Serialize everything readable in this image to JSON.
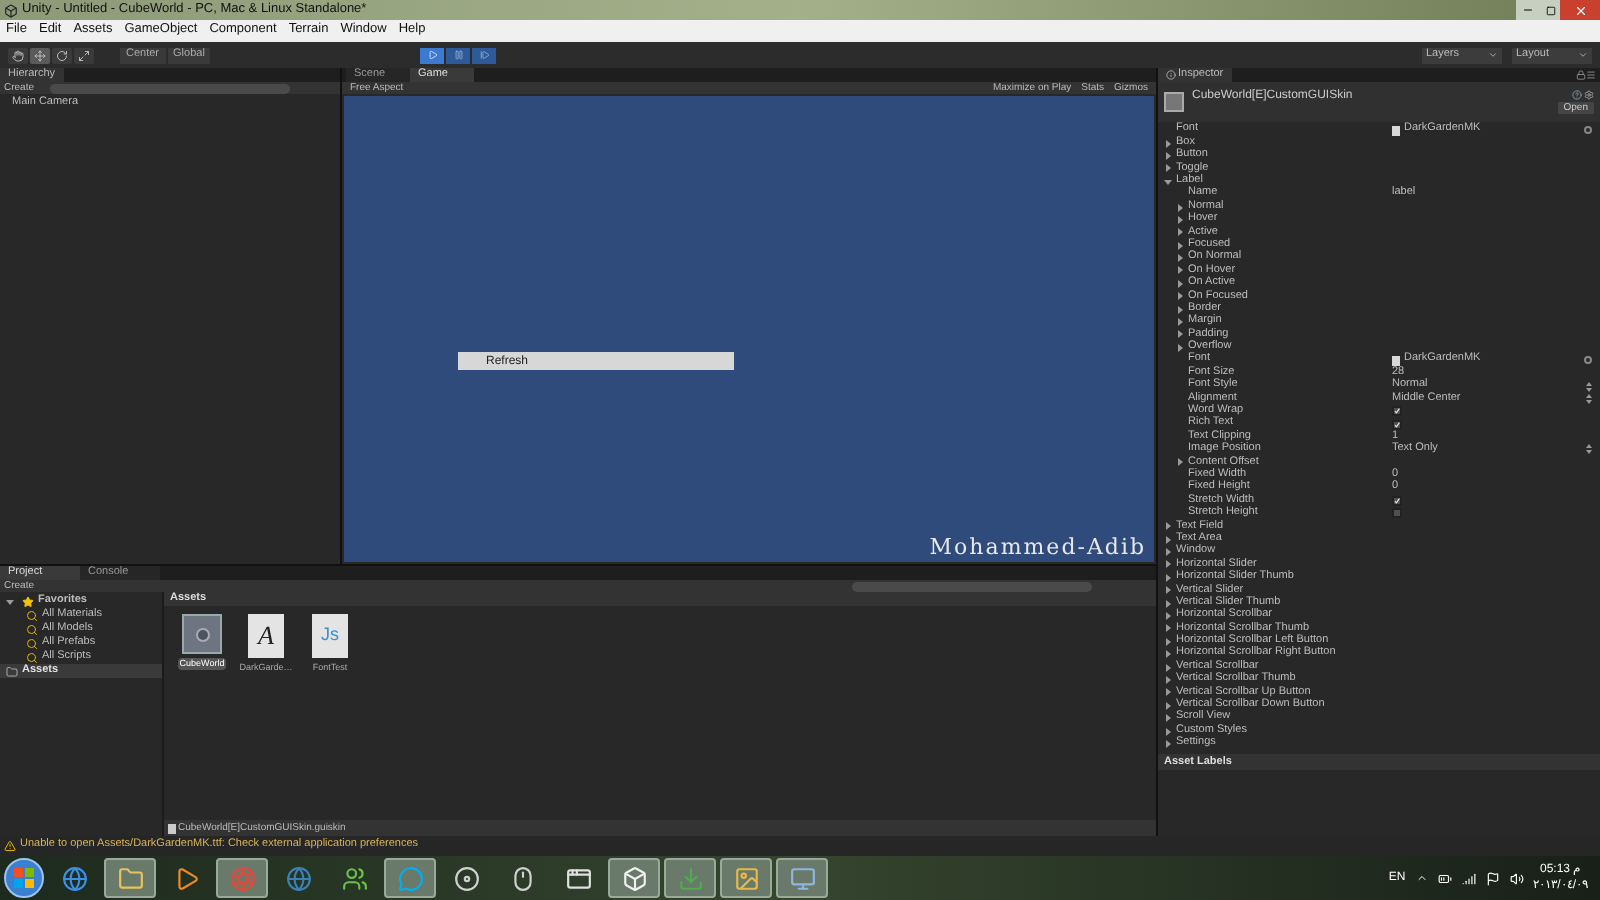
{
  "window": {
    "title": "Unity - Untitled - CubeWorld - PC, Mac & Linux Standalone*"
  },
  "menu": [
    "File",
    "Edit",
    "Assets",
    "GameObject",
    "Component",
    "Terrain",
    "Window",
    "Help"
  ],
  "toolbar": {
    "tools": [
      {
        "kind": "hand",
        "selected": false
      },
      {
        "kind": "move",
        "selected": true
      },
      {
        "kind": "rotate",
        "selected": false
      },
      {
        "kind": "scale",
        "selected": false
      }
    ],
    "pivot": [
      "Center",
      "Global"
    ],
    "playback": [
      {
        "kind": "play",
        "on": true
      },
      {
        "kind": "pause",
        "on": false
      },
      {
        "kind": "step",
        "on": false
      }
    ],
    "layers": "Layers",
    "layout": "Layout"
  },
  "hierarchy": {
    "tab": "Hierarchy",
    "create": "Create",
    "items": [
      "Main Camera"
    ]
  },
  "game": {
    "tabs": [
      {
        "label": "Scene",
        "selected": false
      },
      {
        "label": "Game",
        "selected": true
      }
    ],
    "aspect": "Free Aspect",
    "options": [
      "Maximize on Play",
      "Stats",
      "Gizmos"
    ],
    "button": "Refresh",
    "label": "Mohammed-Adib"
  },
  "inspector": {
    "tab": "Inspector",
    "asset": "CubeWorld[E]CustomGUISkin",
    "open": "Open",
    "rows": [
      {
        "kind": "object",
        "label": "Font",
        "value": "DarkGardenMK"
      },
      {
        "kind": "foldout",
        "label": "Box",
        "expanded": false
      },
      {
        "kind": "foldout",
        "label": "Button",
        "expanded": false
      },
      {
        "kind": "foldout",
        "label": "Toggle",
        "expanded": false
      },
      {
        "kind": "foldout",
        "label": "Label",
        "expanded": true,
        "children": [
          {
            "kind": "text",
            "label": "Name",
            "value": "label"
          },
          {
            "kind": "foldout",
            "label": "Normal",
            "expanded": false
          },
          {
            "kind": "foldout",
            "label": "Hover",
            "expanded": false
          },
          {
            "kind": "foldout",
            "label": "Active",
            "expanded": false
          },
          {
            "kind": "foldout",
            "label": "Focused",
            "expanded": false
          },
          {
            "kind": "foldout",
            "label": "On Normal",
            "expanded": false
          },
          {
            "kind": "foldout",
            "label": "On Hover",
            "expanded": false
          },
          {
            "kind": "foldout",
            "label": "On Active",
            "expanded": false
          },
          {
            "kind": "foldout",
            "label": "On Focused",
            "expanded": false
          },
          {
            "kind": "foldout",
            "label": "Border",
            "expanded": false
          },
          {
            "kind": "foldout",
            "label": "Margin",
            "expanded": false
          },
          {
            "kind": "foldout",
            "label": "Padding",
            "expanded": false
          },
          {
            "kind": "foldout",
            "label": "Overflow",
            "expanded": false
          },
          {
            "kind": "object",
            "label": "Font",
            "value": "DarkGardenMK"
          },
          {
            "kind": "text",
            "label": "Font Size",
            "value": "28"
          },
          {
            "kind": "enum",
            "label": "Font Style",
            "value": "Normal"
          },
          {
            "kind": "enum",
            "label": "Alignment",
            "value": "Middle Center"
          },
          {
            "kind": "check",
            "label": "Word Wrap",
            "checked": true
          },
          {
            "kind": "check",
            "label": "Rich Text",
            "checked": true
          },
          {
            "kind": "text",
            "label": "Text Clipping",
            "value": "1"
          },
          {
            "kind": "enum",
            "label": "Image Position",
            "value": "Text Only"
          },
          {
            "kind": "foldout",
            "label": "Content Offset",
            "expanded": false
          },
          {
            "kind": "text",
            "label": "Fixed Width",
            "value": "0"
          },
          {
            "kind": "text",
            "label": "Fixed Height",
            "value": "0"
          },
          {
            "kind": "check",
            "label": "Stretch Width",
            "checked": true
          },
          {
            "kind": "check",
            "label": "Stretch Height",
            "checked": false
          }
        ]
      },
      {
        "kind": "foldout",
        "label": "Text Field",
        "expanded": false
      },
      {
        "kind": "foldout",
        "label": "Text Area",
        "expanded": false
      },
      {
        "kind": "foldout",
        "label": "Window",
        "expanded": false
      },
      {
        "kind": "foldout",
        "label": "Horizontal Slider",
        "expanded": false
      },
      {
        "kind": "foldout",
        "label": "Horizontal Slider Thumb",
        "expanded": false
      },
      {
        "kind": "foldout",
        "label": "Vertical Slider",
        "expanded": false
      },
      {
        "kind": "foldout",
        "label": "Vertical Slider Thumb",
        "expanded": false
      },
      {
        "kind": "foldout",
        "label": "Horizontal Scrollbar",
        "expanded": false
      },
      {
        "kind": "foldout",
        "label": "Horizontal Scrollbar Thumb",
        "expanded": false
      },
      {
        "kind": "foldout",
        "label": "Horizontal Scrollbar Left Button",
        "expanded": false
      },
      {
        "kind": "foldout",
        "label": "Horizontal Scrollbar Right Button",
        "expanded": false
      },
      {
        "kind": "foldout",
        "label": "Vertical Scrollbar",
        "expanded": false
      },
      {
        "kind": "foldout",
        "label": "Vertical Scrollbar Thumb",
        "expanded": false
      },
      {
        "kind": "foldout",
        "label": "Vertical Scrollbar Up Button",
        "expanded": false
      },
      {
        "kind": "foldout",
        "label": "Vertical Scrollbar Down Button",
        "expanded": false
      },
      {
        "kind": "foldout",
        "label": "Scroll View",
        "expanded": false
      },
      {
        "kind": "foldout",
        "label": "Custom Styles",
        "expanded": false
      },
      {
        "kind": "foldout",
        "label": "Settings",
        "expanded": false
      }
    ],
    "footer": "Asset Labels"
  },
  "project": {
    "tabs": [
      {
        "label": "Project",
        "selected": true
      },
      {
        "label": "Console",
        "selected": false
      }
    ],
    "create": "Create",
    "tree": [
      {
        "kind": "favorites",
        "label": "Favorites",
        "expanded": true,
        "selected": false,
        "children": [
          {
            "kind": "search",
            "label": "All Materials",
            "selected": false
          },
          {
            "kind": "search",
            "label": "All Models",
            "selected": false
          },
          {
            "kind": "search",
            "label": "All Prefabs",
            "selected": false
          },
          {
            "kind": "search",
            "label": "All Scripts",
            "selected": false
          }
        ]
      },
      {
        "kind": "folder",
        "label": "Assets",
        "selected": true
      }
    ],
    "folder": "Assets",
    "assets": [
      {
        "kind": "skin",
        "name": "CubeWorld",
        "selected": true
      },
      {
        "kind": "font",
        "name": "DarkGarde…",
        "glyph": "A",
        "selected": false
      },
      {
        "kind": "script",
        "name": "FontTest",
        "glyph": "Js",
        "selected": false
      }
    ],
    "path": "CubeWorld[E]CustomGUISkin.guiskin"
  },
  "status": {
    "message": "Unable to open Assets/DarkGardenMK.ttf: Check external application preferences"
  },
  "taskbar": {
    "apps": [
      {
        "kind": "ie",
        "open": false
      },
      {
        "kind": "explorer",
        "open": true
      },
      {
        "kind": "media",
        "open": false
      },
      {
        "kind": "chrome",
        "open": true
      },
      {
        "kind": "globe",
        "open": false
      },
      {
        "kind": "messenger",
        "open": false
      },
      {
        "kind": "skype",
        "open": true
      },
      {
        "kind": "disc",
        "open": false
      },
      {
        "kind": "mouse",
        "open": false
      },
      {
        "kind": "window",
        "open": false
      },
      {
        "kind": "unity",
        "open": true
      },
      {
        "kind": "torrent",
        "open": true
      },
      {
        "kind": "image",
        "open": true
      },
      {
        "kind": "remote",
        "open": true
      }
    ],
    "language": "EN",
    "time": "05:13 م",
    "date": "٢٠١٣/٠٤/٠٩"
  }
}
